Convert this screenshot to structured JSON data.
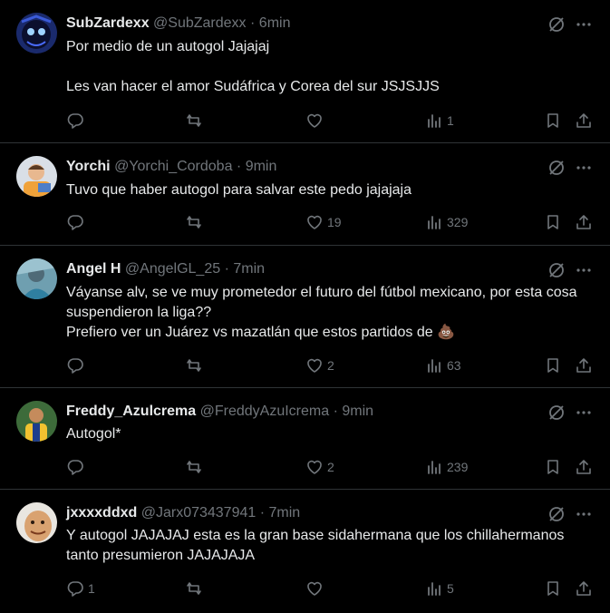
{
  "tweets": [
    {
      "name": "SubZardexx",
      "handle": "@SubZardexx",
      "time": "6min",
      "lines": [
        "Por medio de un autogol Jajajaj",
        "",
        "Les van hacer el amor Sudáfrica y Corea del sur JSJSJJS"
      ],
      "replies": "",
      "reposts": "",
      "likes": "",
      "views": "1"
    },
    {
      "name": "Yorchi",
      "handle": "@Yorchi_Cordoba",
      "time": "9min",
      "lines": [
        "Tuvo que haber autogol para salvar este pedo jajajaja"
      ],
      "replies": "",
      "reposts": "",
      "likes": "19",
      "views": "329"
    },
    {
      "name": "Angel H",
      "handle": "@AngelGL_25",
      "time": "7min",
      "lines": [
        "Váyanse alv, se ve muy prometedor el futuro del fútbol mexicano, por esta cosa suspendieron la liga??",
        "Prefiero ver un Juárez vs mazatlán que estos partidos de 💩"
      ],
      "replies": "",
      "reposts": "",
      "likes": "2",
      "views": "63"
    },
    {
      "name": "Freddy_Azulcrema",
      "handle": "@FreddyAzuIcrema",
      "time": "9min",
      "lines": [
        "Autogol*"
      ],
      "replies": "",
      "reposts": "",
      "likes": "2",
      "views": "239"
    },
    {
      "name": "jxxxxddxd",
      "handle": "@Jarx073437941",
      "time": "7min",
      "lines": [
        "Y autogol JAJAJAJ esta es la gran base sidahermana que los chillahermanos tanto presumieron JAJAJAJA"
      ],
      "replies": "1",
      "reposts": "",
      "likes": "",
      "views": "5"
    }
  ],
  "separator": "·",
  "icons": {
    "reply": "reply-icon",
    "repost": "repost-icon",
    "like": "like-icon",
    "views": "views-icon",
    "bookmark": "bookmark-icon",
    "share": "share-icon",
    "grok": "grok-icon",
    "more": "more-icon"
  },
  "colors": {
    "background": "#000000",
    "text": "#e7e9ea",
    "muted": "#71767b",
    "border": "#2f3336"
  }
}
